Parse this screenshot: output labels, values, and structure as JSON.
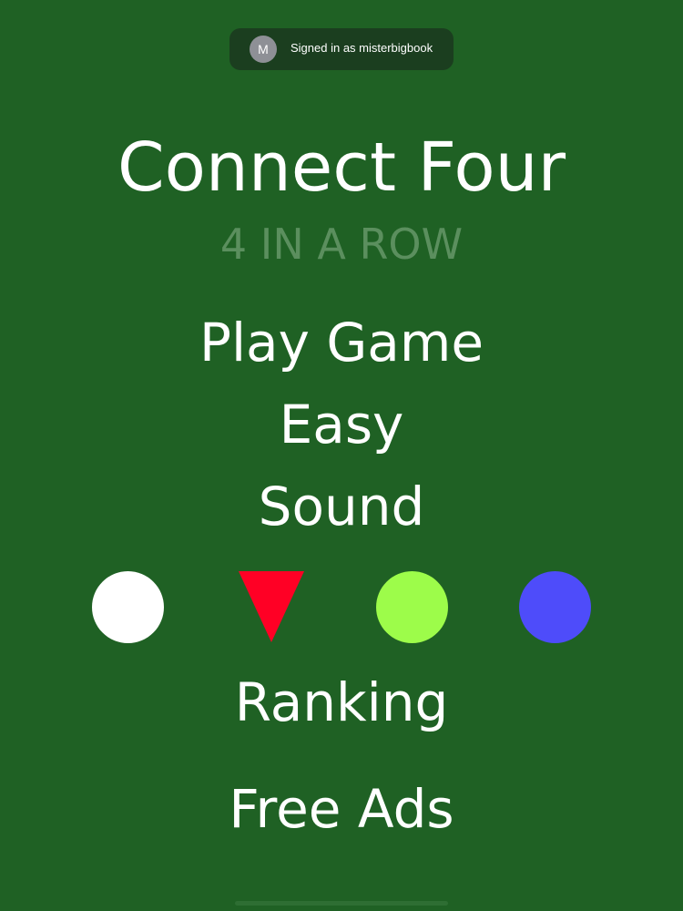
{
  "banner": {
    "avatar_letter": "M",
    "text": "Signed in as misterbigbook"
  },
  "title": "Connect Four",
  "subtitle": "4 IN A ROW",
  "menu": {
    "play": "Play Game",
    "difficulty": "Easy",
    "sound": "Sound",
    "ranking": "Ranking",
    "free_ads": "Free Ads"
  },
  "color_choices": [
    {
      "name": "white",
      "color": "#ffffff",
      "shape": "circle"
    },
    {
      "name": "red",
      "color": "#ff0025",
      "shape": "triangle",
      "selected": true
    },
    {
      "name": "green",
      "color": "#9dfc4a",
      "shape": "circle"
    },
    {
      "name": "blue",
      "color": "#4e4cfa",
      "shape": "circle"
    }
  ],
  "colors": {
    "background": "#1f6124",
    "banner": "#1b3e1f",
    "subtitle": "#5b8f5e"
  }
}
